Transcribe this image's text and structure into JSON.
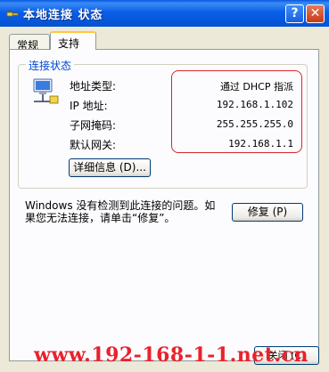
{
  "window": {
    "title": "本地连接 状态",
    "help_label": "?",
    "close_label": "✕",
    "colors": {
      "titlebar": "#0a5ee8",
      "highlight_border": "#d9262d",
      "group_title": "#0046d5",
      "watermark": "#e8222c"
    }
  },
  "tabs": [
    {
      "label": "常规",
      "selected": false
    },
    {
      "label": "支持",
      "selected": true
    }
  ],
  "status_group": {
    "title": "连接状态",
    "icon": "network-connection-icon",
    "rows": [
      {
        "label": "地址类型:",
        "value": "通过 DHCP 指派"
      },
      {
        "label": "IP 地址:",
        "value": "192.168.1.102"
      },
      {
        "label": "子网掩码:",
        "value": "255.255.255.0"
      },
      {
        "label": "默认网关:",
        "value": "192.168.1.1"
      }
    ],
    "details_button": "详细信息 (D)..."
  },
  "message": "Windows 没有检测到此连接的问题。如果您无法连接，请单击“修复”。",
  "repair_button": "修复 (P)",
  "close_button": "关闭 (C)",
  "watermark": "www.192-168-1-1.net.cn"
}
